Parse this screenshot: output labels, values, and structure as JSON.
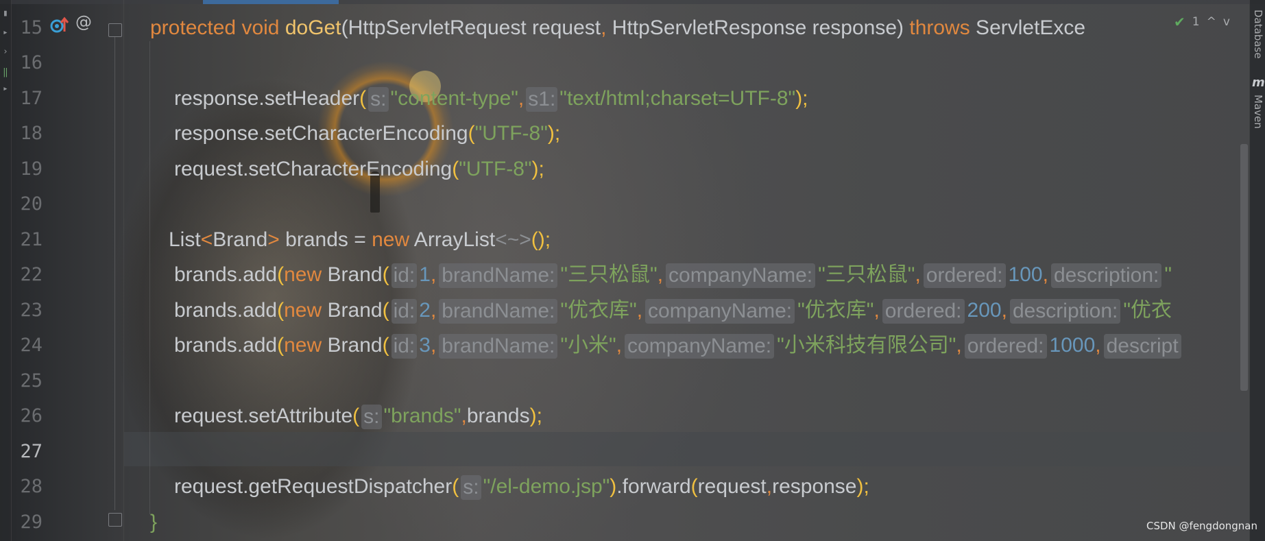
{
  "editor": {
    "line_numbers": [
      "15",
      "16",
      "17",
      "18",
      "19",
      "20",
      "21",
      "22",
      "23",
      "24",
      "25",
      "26",
      "27",
      "28",
      "29"
    ],
    "current_line": "27",
    "lines": {
      "l15": {
        "protected": "protected",
        "void": "void",
        "method": "doGet",
        "open": "(",
        "p1type": "HttpServletRequest",
        "p1name": " request",
        "comma": ",",
        "p2type": " HttpServletResponse",
        "p2name": " response",
        "close": ")",
        "throws": "throws",
        "exc": " ServletExce"
      },
      "l17": {
        "call": "response.setHeader",
        "open": "(",
        "hint1": "s:",
        "arg1": "\"content-type\"",
        "comma": ",",
        "hint2": "s1:",
        "arg2": "\"text/html;charset=UTF-8\"",
        "close": ");"
      },
      "l18": {
        "call": "response.setCharacterEncoding",
        "open": "(",
        "arg": "\"UTF-8\"",
        "close": ");"
      },
      "l19": {
        "call": "request.setCharacterEncoding",
        "open": "(",
        "arg": "\"UTF-8\"",
        "close": ");"
      },
      "l21": {
        "list": "List",
        "lt": "<",
        "brand": "Brand",
        "gt": ">",
        "var": " brands = ",
        "new": "new",
        "cls": " ArrayList",
        "diamond": "<~>",
        "end": "();"
      },
      "l22": {
        "call": "brands.add",
        "open": "(",
        "new": "new",
        "cls": " Brand",
        "open2": "(",
        "h_id": "id:",
        "id": "1",
        "h_bn": "brandName:",
        "bn": "\"三只松鼠\"",
        "h_cn": "companyName:",
        "cn": "\"三只松鼠\"",
        "h_ord": "ordered:",
        "ord": "100",
        "h_desc": "description:",
        "desc": "\""
      },
      "l23": {
        "call": "brands.add",
        "open": "(",
        "new": "new",
        "cls": " Brand",
        "open2": "(",
        "h_id": "id:",
        "id": "2",
        "h_bn": "brandName:",
        "bn": "\"优衣库\"",
        "h_cn": "companyName:",
        "cn": "\"优衣库\"",
        "h_ord": "ordered:",
        "ord": "200",
        "h_desc": "description:",
        "desc": "\"优衣"
      },
      "l24": {
        "call": "brands.add",
        "open": "(",
        "new": "new",
        "cls": " Brand",
        "open2": "(",
        "h_id": "id:",
        "id": "3",
        "h_bn": "brandName:",
        "bn": "\"小米\"",
        "h_cn": "companyName:",
        "cn": "\"小米科技有限公司\"",
        "h_ord": "ordered:",
        "ord": "1000",
        "h_desc": "descript"
      },
      "l26": {
        "call": "request.setAttribute",
        "open": "(",
        "hint": "s:",
        "arg": "\"brands\"",
        "comma": ",",
        "arg2": "brands",
        "close": ");"
      },
      "l28": {
        "call": "request.getRequestDispatcher",
        "open": "(",
        "hint": "s:",
        "arg": "\"/el-demo.jsp\"",
        "close1": ")",
        "fwd": ".forward",
        "open2": "(",
        "a1": "request",
        "comma": ",",
        "a2": "response",
        "close2": ");"
      },
      "l29": {
        "brace": "}"
      }
    }
  },
  "inspection": {
    "count": "1",
    "up": "^",
    "down": "v"
  },
  "side_tools": {
    "database": "Database",
    "maven": "Maven",
    "maven_icon": "m"
  },
  "gutter_icons": {
    "implements": "override-up-icon",
    "annotation": "@"
  },
  "watermark": "CSDN @fengdongnan",
  "colors": {
    "keyword": "#e1883f",
    "method": "#f0c46c",
    "string": "#7ea35d",
    "number": "#6897bb",
    "text": "#c8cbcf",
    "paren": "#f0c040"
  }
}
